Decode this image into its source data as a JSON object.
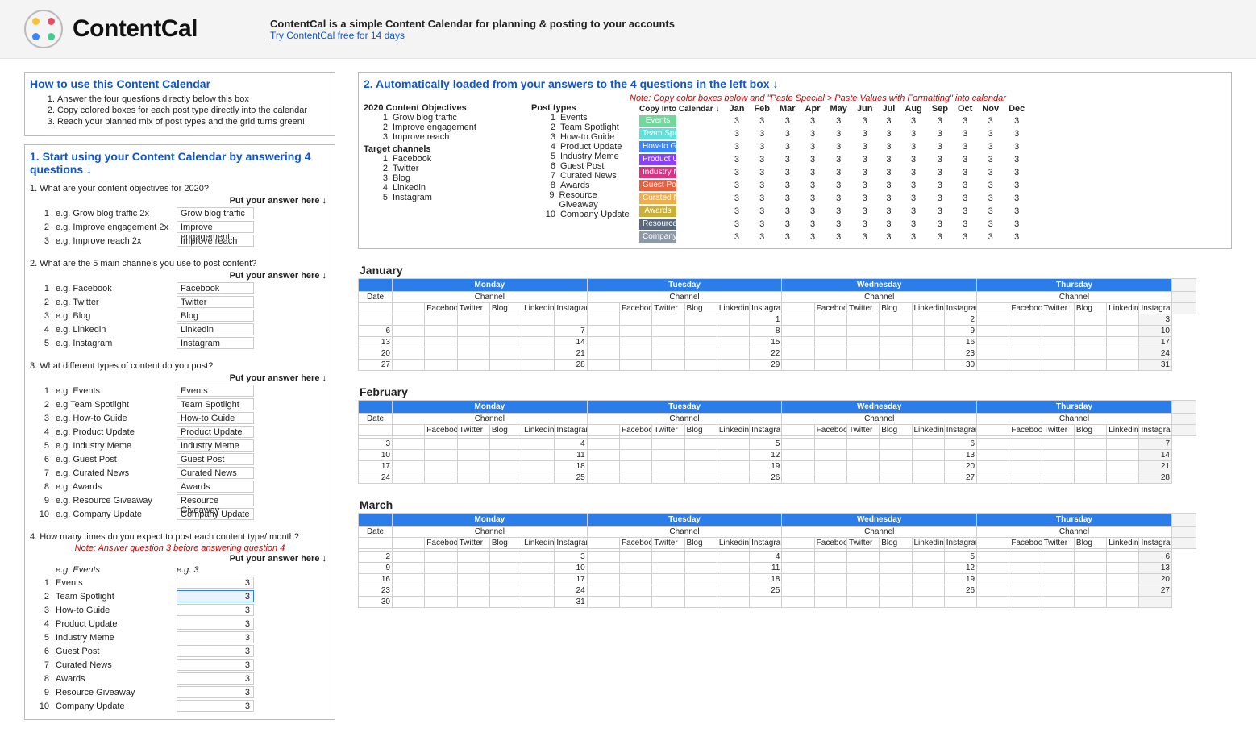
{
  "header": {
    "brand": "ContentCal",
    "tagline": "ContentCal is a simple Content Calendar for planning & posting to your accounts",
    "cta": "Try ContentCal free for 14 days"
  },
  "howto": {
    "title": "How to use this Content Calendar",
    "steps": [
      "Answer the four questions directly below this box",
      "Copy colored boxes for each post type directly into the calendar",
      "Reach your planned mix of post types and the grid turns green!"
    ]
  },
  "section1": {
    "title": "1. Start using your Content Calendar by answering 4 questions ↓",
    "answer_header": "Put your answer here ↓",
    "q1": {
      "label": "1. What are your content objectives for 2020?",
      "rows": [
        {
          "n": "1",
          "eg": "e.g. Grow blog traffic 2x",
          "val": "Grow blog traffic"
        },
        {
          "n": "2",
          "eg": "e.g. Improve engagement 2x",
          "val": "Improve engagement"
        },
        {
          "n": "3",
          "eg": "e.g. Improve reach 2x",
          "val": "Improve reach"
        }
      ]
    },
    "q2": {
      "label": "2. What are the 5 main channels you use to post content?",
      "rows": [
        {
          "n": "1",
          "eg": "e.g. Facebook",
          "val": "Facebook"
        },
        {
          "n": "2",
          "eg": "e.g. Twitter",
          "val": "Twitter"
        },
        {
          "n": "3",
          "eg": "e.g. Blog",
          "val": "Blog"
        },
        {
          "n": "4",
          "eg": "e.g. Linkedin",
          "val": "Linkedin"
        },
        {
          "n": "5",
          "eg": "e.g. Instagram",
          "val": "Instagram"
        }
      ]
    },
    "q3": {
      "label": "3. What different types of content do you post?",
      "rows": [
        {
          "n": "1",
          "eg": "e.g. Events",
          "val": "Events"
        },
        {
          "n": "2",
          "eg": "e.g Team Spotlight",
          "val": "Team Spotlight"
        },
        {
          "n": "3",
          "eg": "e.g. How-to Guide",
          "val": "How-to Guide"
        },
        {
          "n": "4",
          "eg": "e.g. Product Update",
          "val": "Product Update"
        },
        {
          "n": "5",
          "eg": "e.g. Industry Meme",
          "val": "Industry Meme"
        },
        {
          "n": "6",
          "eg": "e.g. Guest Post",
          "val": "Guest Post"
        },
        {
          "n": "7",
          "eg": "e.g. Curated News",
          "val": "Curated News"
        },
        {
          "n": "8",
          "eg": "e.g. Awards",
          "val": "Awards"
        },
        {
          "n": "9",
          "eg": "e.g. Resource Giveaway",
          "val": "Resource Giveaway"
        },
        {
          "n": "10",
          "eg": "e.g. Company Update",
          "val": "Company Update"
        }
      ]
    },
    "q4": {
      "label": "4. How many times do you expect to post each content type/ month?",
      "note": "Note: Answer question 3 before answering question 4",
      "eg_row": {
        "eg": "e.g. Events",
        "val": "e.g. 3"
      },
      "rows": [
        {
          "n": "1",
          "eg": "Events",
          "val": "3"
        },
        {
          "n": "2",
          "eg": "Team Spotlight",
          "val": "3"
        },
        {
          "n": "3",
          "eg": "How-to Guide",
          "val": "3"
        },
        {
          "n": "4",
          "eg": "Product Update",
          "val": "3"
        },
        {
          "n": "5",
          "eg": "Industry Meme",
          "val": "3"
        },
        {
          "n": "6",
          "eg": "Guest Post",
          "val": "3"
        },
        {
          "n": "7",
          "eg": "Curated News",
          "val": "3"
        },
        {
          "n": "8",
          "eg": "Awards",
          "val": "3"
        },
        {
          "n": "9",
          "eg": "Resource Giveaway",
          "val": "3"
        },
        {
          "n": "10",
          "eg": "Company Update",
          "val": "3"
        }
      ]
    }
  },
  "section2": {
    "title": "2. Automatically loaded from your answers to the 4 questions in the left box ↓",
    "note": "Note: Copy color boxes below and \"Paste Special > Paste Values with Formatting\" into calendar",
    "hdr_objectives": "2020 Content Objectives",
    "hdr_posttypes": "Post types",
    "hdr_copy": "Copy Into Calendar ↓",
    "hdr_target": "Target channels",
    "objectives": [
      {
        "n": "1",
        "v": "Grow blog traffic"
      },
      {
        "n": "2",
        "v": "Improve engagement"
      },
      {
        "n": "3",
        "v": "Improve reach"
      }
    ],
    "channels": [
      {
        "n": "1",
        "v": "Facebook"
      },
      {
        "n": "2",
        "v": "Twitter"
      },
      {
        "n": "3",
        "v": "Blog"
      },
      {
        "n": "4",
        "v": "Linkedin"
      },
      {
        "n": "5",
        "v": "Instagram"
      }
    ],
    "posttypes": [
      {
        "n": "1",
        "v": "Events",
        "chip": "Events",
        "color": "#6fd89a"
      },
      {
        "n": "2",
        "v": "Team Spotlight",
        "chip": "Team Spotl",
        "color": "#5fe0d8"
      },
      {
        "n": "3",
        "v": "How-to Guide",
        "chip": "How-to Guid",
        "color": "#3a86ff"
      },
      {
        "n": "4",
        "v": "Product Update",
        "chip": "Product Upd",
        "color": "#8a3ffc"
      },
      {
        "n": "5",
        "v": "Industry Meme",
        "chip": "Industry Mem",
        "color": "#d63384"
      },
      {
        "n": "6",
        "v": "Guest Post",
        "chip": "Guest Post",
        "color": "#e8603c"
      },
      {
        "n": "7",
        "v": "Curated News",
        "chip": "Curated New",
        "color": "#f0ad4e"
      },
      {
        "n": "8",
        "v": "Awards",
        "chip": "Awards",
        "color": "#c9b037"
      },
      {
        "n": "9",
        "v": "Resource Giveaway",
        "chip": "Resource Giv",
        "color": "#5a6a7e"
      },
      {
        "n": "10",
        "v": "Company Update",
        "chip": "Company Up",
        "color": "#8d99a6"
      }
    ],
    "months": [
      "Jan",
      "Feb",
      "Mar",
      "Apr",
      "May",
      "Jun",
      "Jul",
      "Aug",
      "Sep",
      "Oct",
      "Nov",
      "Dec"
    ],
    "cell_value": "3"
  },
  "calendar": {
    "days": [
      "Monday",
      "Tuesday",
      "Wednesday",
      "Thursday"
    ],
    "date_label": "Date",
    "channel_label": "Channel",
    "channels": [
      "Facebook",
      "Twitter",
      "Blog",
      "Linkedin",
      "Instagram"
    ],
    "months": [
      {
        "name": "January",
        "weeks": [
          {
            "mon": "",
            "tue": "",
            "wed": "1",
            "thu": "2",
            "end": "3"
          },
          {
            "mon": "6",
            "tue": "7",
            "wed": "8",
            "thu": "9",
            "end": "10"
          },
          {
            "mon": "13",
            "tue": "14",
            "wed": "15",
            "thu": "16",
            "end": "17"
          },
          {
            "mon": "20",
            "tue": "21",
            "wed": "22",
            "thu": "23",
            "end": "24"
          },
          {
            "mon": "27",
            "tue": "28",
            "wed": "29",
            "thu": "30",
            "end": "31"
          }
        ]
      },
      {
        "name": "February",
        "weeks": [
          {
            "mon": "",
            "tue": "",
            "wed": "",
            "thu": "",
            "end": ""
          },
          {
            "mon": "3",
            "tue": "4",
            "wed": "5",
            "thu": "6",
            "end": "7"
          },
          {
            "mon": "10",
            "tue": "11",
            "wed": "12",
            "thu": "13",
            "end": "14"
          },
          {
            "mon": "17",
            "tue": "18",
            "wed": "19",
            "thu": "20",
            "end": "21"
          },
          {
            "mon": "24",
            "tue": "25",
            "wed": "26",
            "thu": "27",
            "end": "28"
          }
        ]
      },
      {
        "name": "March",
        "weeks": [
          {
            "mon": "",
            "tue": "",
            "wed": "",
            "thu": "",
            "end": ""
          },
          {
            "mon": "2",
            "tue": "3",
            "wed": "4",
            "thu": "5",
            "end": "6"
          },
          {
            "mon": "9",
            "tue": "10",
            "wed": "11",
            "thu": "12",
            "end": "13"
          },
          {
            "mon": "16",
            "tue": "17",
            "wed": "18",
            "thu": "19",
            "end": "20"
          },
          {
            "mon": "23",
            "tue": "24",
            "wed": "25",
            "thu": "26",
            "end": "27"
          },
          {
            "mon": "30",
            "tue": "31",
            "wed": "",
            "thu": "",
            "end": ""
          }
        ]
      }
    ]
  }
}
